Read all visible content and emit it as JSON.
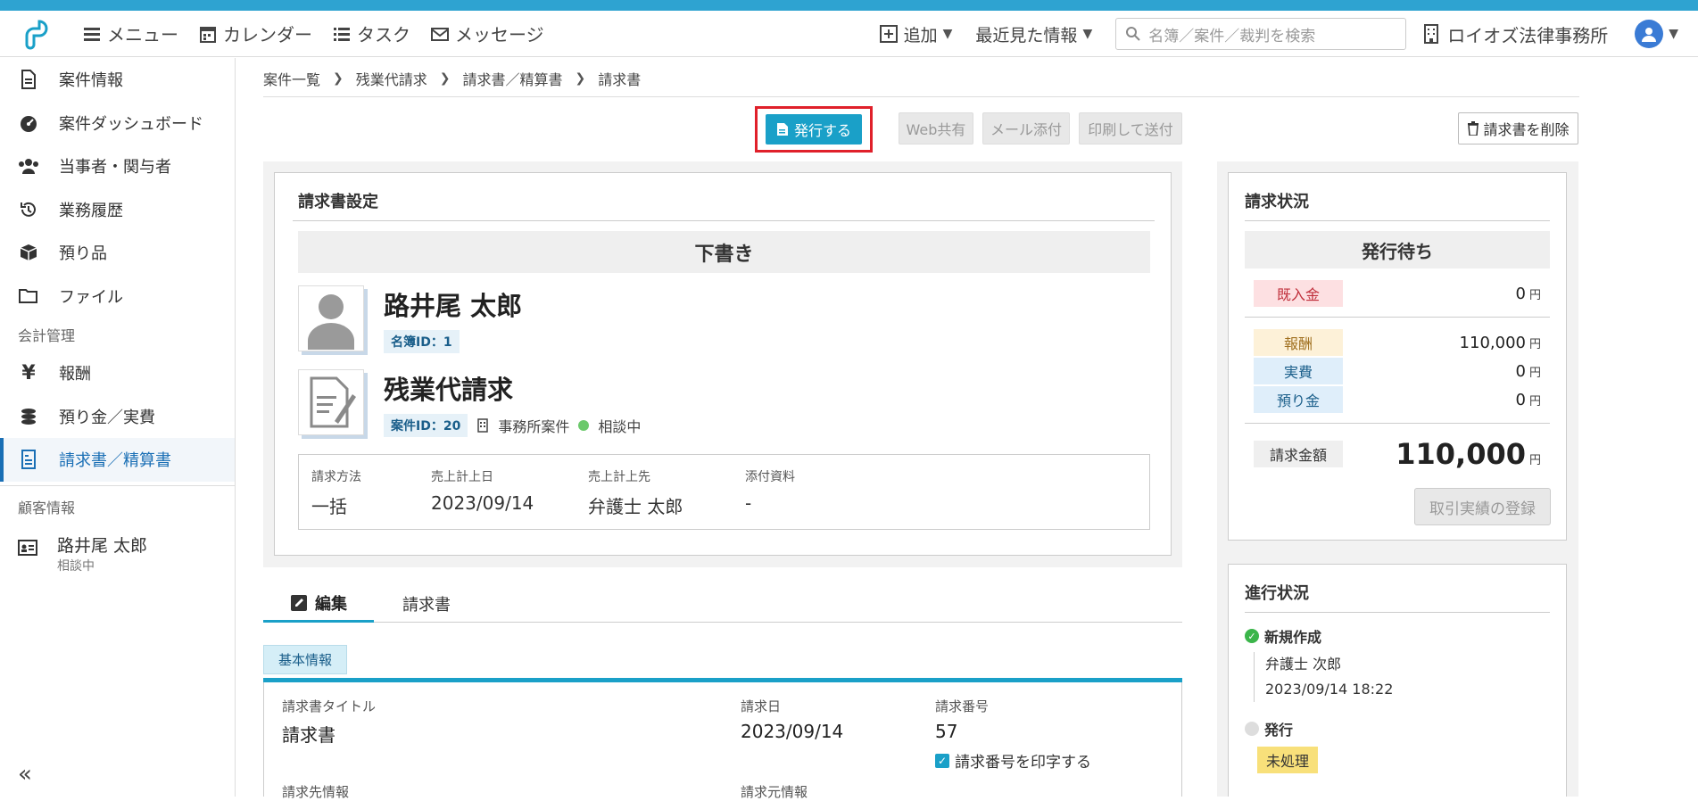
{
  "header": {
    "menu": "メニュー",
    "calendar": "カレンダー",
    "task": "タスク",
    "message": "メッセージ",
    "add": "追加",
    "recent": "最近見た情報",
    "search_placeholder": "名簿／案件／裁判を検索",
    "office": "ロイオズ法律事務所"
  },
  "sidebar": {
    "items": [
      {
        "label": "案件情報",
        "icon": "document-icon"
      },
      {
        "label": "案件ダッシュボード",
        "icon": "dashboard-icon"
      },
      {
        "label": "当事者・関与者",
        "icon": "people-icon"
      },
      {
        "label": "業務履歴",
        "icon": "history-icon"
      },
      {
        "label": "預り品",
        "icon": "box-icon"
      },
      {
        "label": "ファイル",
        "icon": "folder-icon"
      }
    ],
    "accounting_group": "会計管理",
    "accounting_items": [
      {
        "label": "報酬",
        "icon": "yen-icon"
      },
      {
        "label": "預り金／実費",
        "icon": "coins-icon"
      },
      {
        "label": "請求書／精算書",
        "icon": "invoice-icon"
      }
    ],
    "client_group": "顧客情報",
    "client_name": "路井尾 太郎",
    "client_status": "相談中"
  },
  "breadcrumb": [
    "案件一覧",
    "残業代請求",
    "請求書／精算書",
    "請求書"
  ],
  "toolbar": {
    "issue": "発行する",
    "web_share": "Web共有",
    "mail_attach": "メール添付",
    "print_send": "印刷して送付",
    "delete": "請求書を削除"
  },
  "settings": {
    "title": "請求書設定",
    "status": "下書き",
    "person_name": "路井尾 太郎",
    "person_id": "名簿ID：1",
    "matter_name": "残業代請求",
    "matter_id": "案件ID：20",
    "matter_type": "事務所案件",
    "matter_status": "相談中",
    "info": {
      "method_label": "請求方法",
      "method": "一括",
      "date_label": "売上計上日",
      "date": "2023/09/14",
      "to_label": "売上計上先",
      "to": "弁護士 太郎",
      "attach_label": "添付資料",
      "attach": "-"
    }
  },
  "tabs": {
    "edit": "編集",
    "invoice": "請求書"
  },
  "basic": {
    "badge": "基本情報",
    "title_label": "請求書タイトル",
    "title": "請求書",
    "date_label": "請求日",
    "date": "2023/09/14",
    "number_label": "請求番号",
    "number": "57",
    "print_number": "請求番号を印字する",
    "to_info": "請求先情報",
    "from_info": "請求元情報"
  },
  "billing": {
    "title": "請求状況",
    "status": "発行待ち",
    "received_label": "既入金",
    "received": "0",
    "fee_label": "報酬",
    "fee": "110,000",
    "expense_label": "実費",
    "expense": "0",
    "deposit_label": "預り金",
    "deposit": "0",
    "total_label": "請求金額",
    "total": "110,000",
    "yen": "円",
    "register_button": "取引実績の登録"
  },
  "progress": {
    "title": "進行状況",
    "step1": "新規作成",
    "step1_person": "弁護士 次郎",
    "step1_time": "2023/09/14 18:22",
    "step2": "発行",
    "step2_badge": "未処理"
  },
  "colors": {
    "accent": "#1aa0c8",
    "highlight": "#e0202a"
  }
}
